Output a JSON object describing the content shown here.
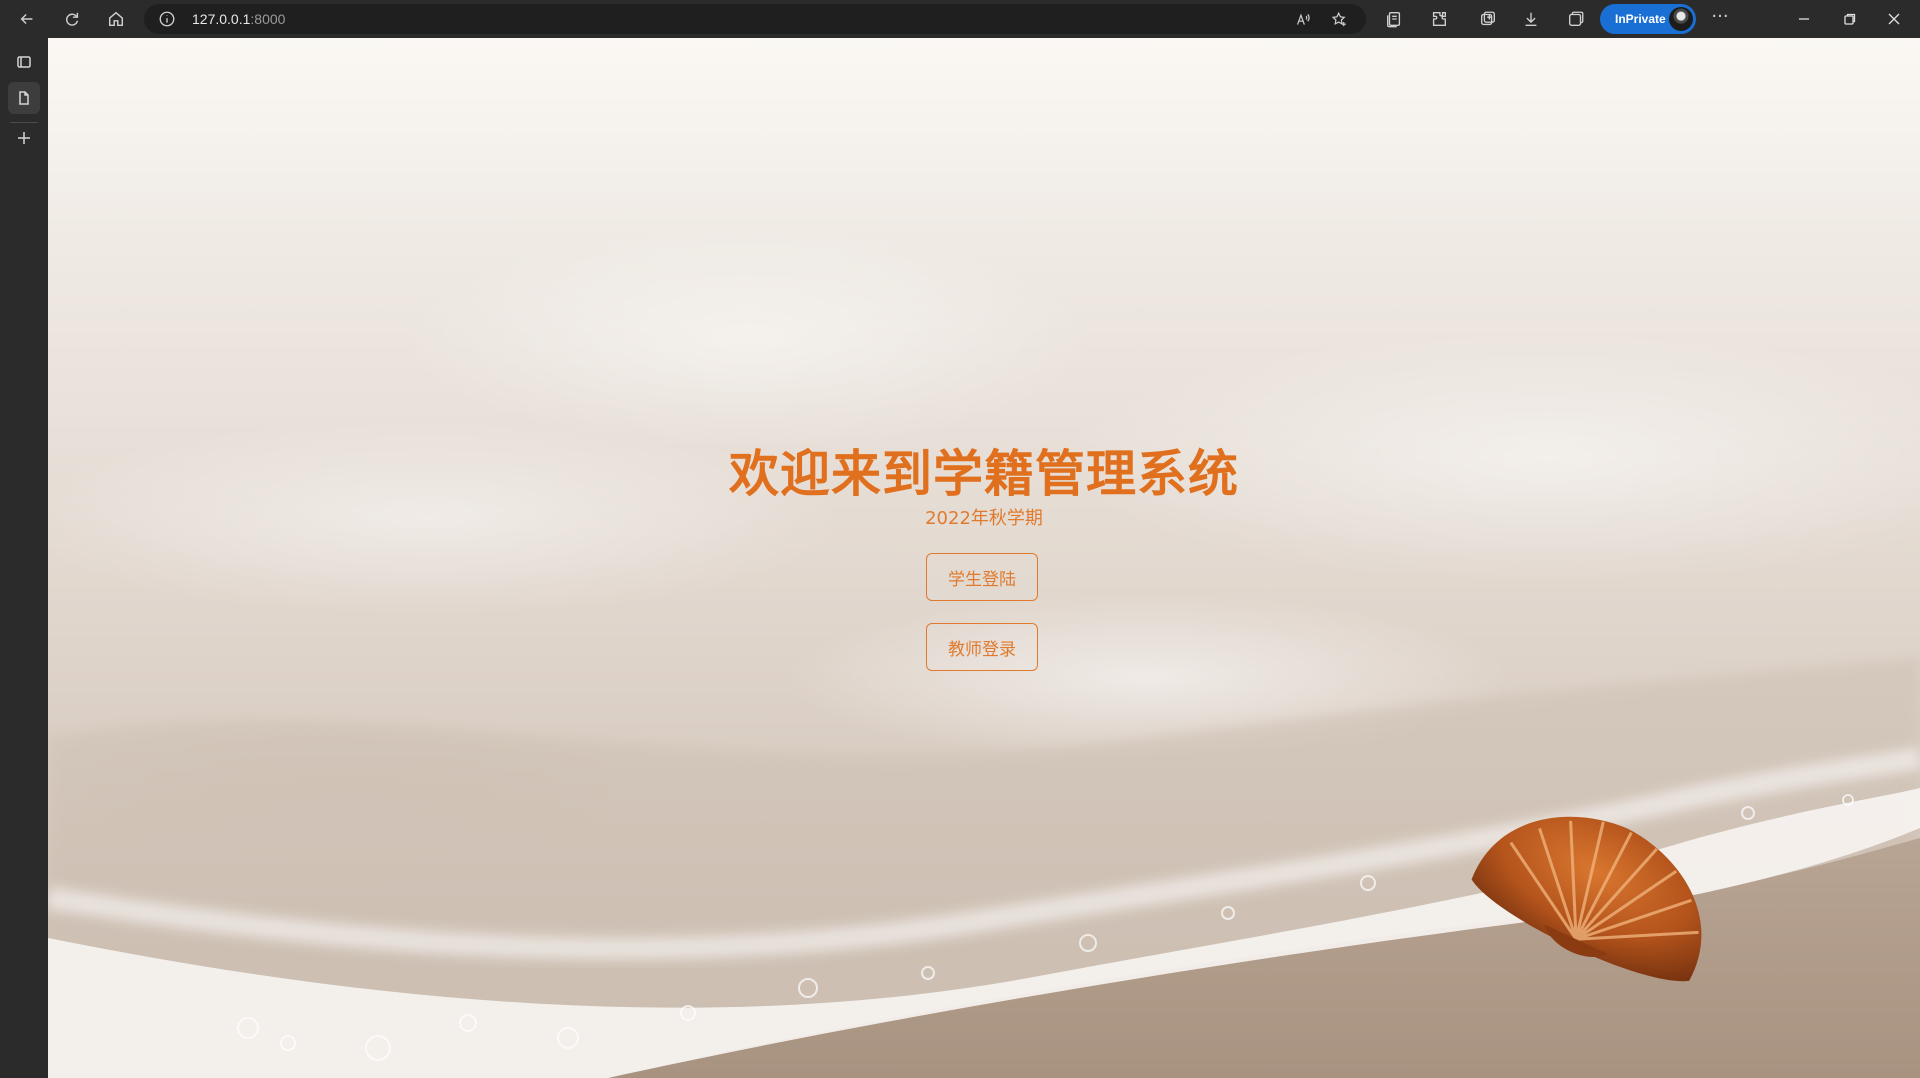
{
  "browser": {
    "url_host": "127.0.0.1",
    "url_port": ":8000",
    "inprivate_label": "InPrivate"
  },
  "page": {
    "title": "欢迎来到学籍管理系统",
    "subtitle": "2022年秋学期",
    "buttons": [
      {
        "label": "学生登陆"
      },
      {
        "label": "教师登录"
      }
    ]
  },
  "colors": {
    "accent": "#e0701e",
    "browser_chrome": "#2b2b2b",
    "inprivate": "#1a6fd4"
  },
  "icons": {
    "toolbar": [
      "back-icon",
      "refresh-icon",
      "home-icon",
      "info-icon",
      "read-aloud-icon",
      "favorite-icon",
      "collections-icon",
      "extensions-icon",
      "tab-actions-icon",
      "download-icon",
      "split-screen-icon",
      "more-icon"
    ],
    "sidebar": [
      "tab-panel-icon",
      "page-icon",
      "plus-icon"
    ],
    "window": [
      "minimize-icon",
      "restore-icon",
      "close-icon"
    ]
  }
}
